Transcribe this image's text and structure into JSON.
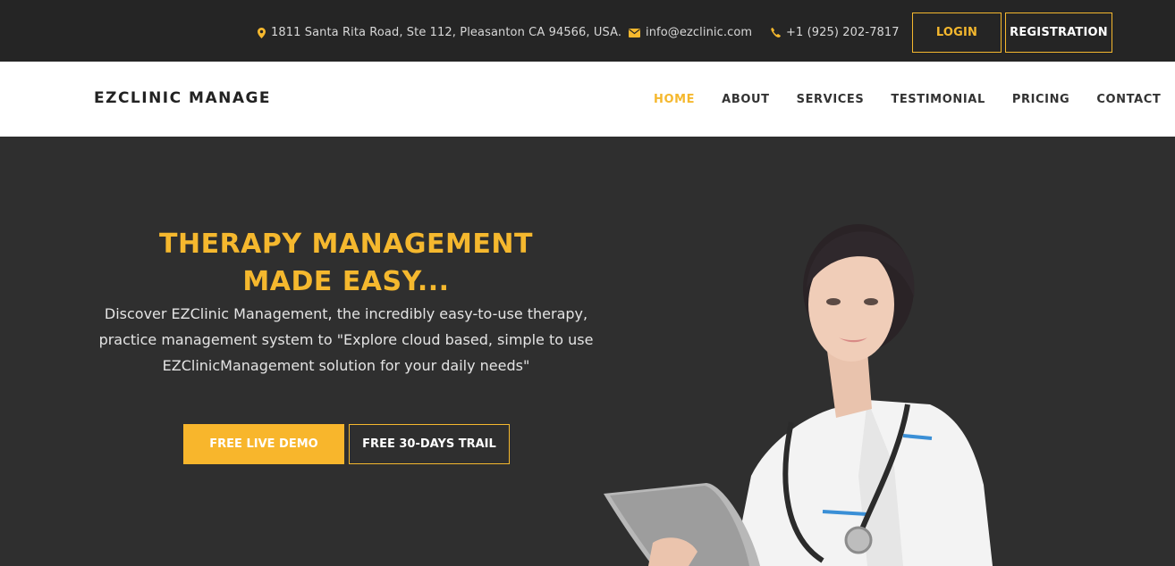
{
  "topbar": {
    "address": "1811 Santa Rita Road, Ste 112, Pleasanton CA 94566, USA.",
    "email": "info@ezclinic.com",
    "phone": "+1 (925) 202-7817",
    "login_label": "LOGIN",
    "registration_label": "REGISTRATION"
  },
  "navbar": {
    "brand": "EZCLINIC MANAGE",
    "items": [
      {
        "label": "HOME",
        "active": true
      },
      {
        "label": "ABOUT"
      },
      {
        "label": "SERVICES"
      },
      {
        "label": "TESTIMONIAL"
      },
      {
        "label": "PRICING"
      },
      {
        "label": "CONTACT"
      }
    ]
  },
  "hero": {
    "title_line1": "THERAPY MANAGEMENT",
    "title_line2": "MADE EASY...",
    "description": "Discover EZClinic Management, the incredibly easy-to-use therapy, practice management system to \"Explore cloud based, simple to use EZClinicManagement solution for your daily needs\"",
    "demo_label": "FREE LIVE DEMO",
    "trail_label": "FREE 30-DAYS TRAIL"
  },
  "colors": {
    "accent": "#f5b82e",
    "topbar_bg": "#252525",
    "hero_bg": "#2f2f2f",
    "nav_bg": "#ffffff"
  },
  "icons": {
    "address": "map-marker-icon",
    "email": "envelope-icon",
    "phone": "phone-icon"
  }
}
